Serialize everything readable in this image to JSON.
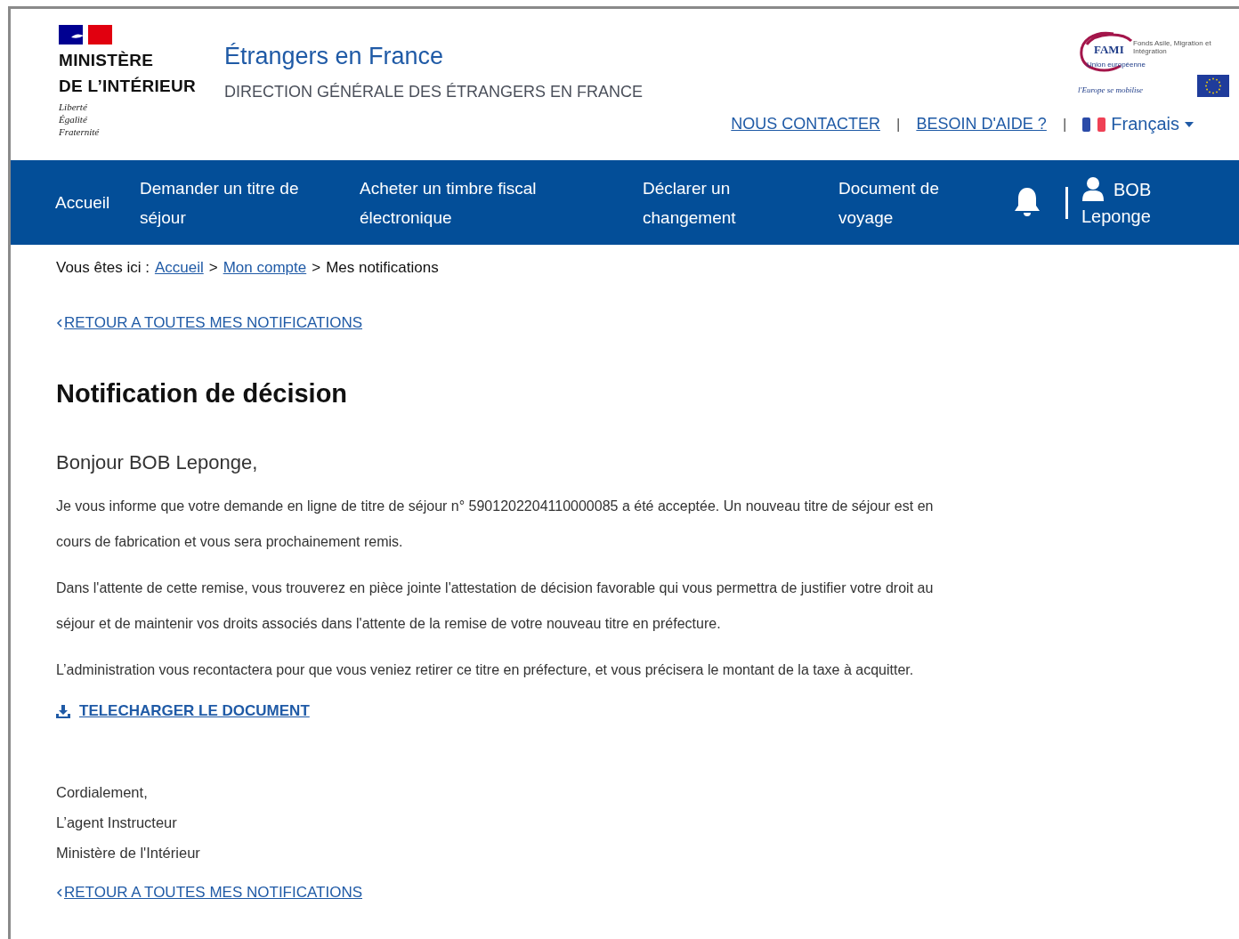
{
  "header": {
    "ministry_name": [
      "MINISTÈRE",
      "DE L’INTÉRIEUR"
    ],
    "motto": [
      "Liberté",
      "Égalité",
      "Fraternité"
    ],
    "site_title": "Étrangers en France",
    "site_subtitle": "DIRECTION GÉNÉRALE DES ÉTRANGERS EN FRANCE",
    "fami_logo": {
      "name": "FAMI",
      "fund": "Fonds Asile, Migration et Intégration",
      "union": "Union européenne",
      "slogan": "l'Europe se mobilise"
    },
    "links": [
      "NOUS CONTACTER",
      "BESOIN D'AIDE ?"
    ],
    "separators": [
      "|",
      "|"
    ],
    "language": "Français"
  },
  "nav": {
    "items": [
      {
        "label": "Accueil"
      },
      {
        "label": "Demander un titre de séjour"
      },
      {
        "label": "Acheter un timbre fiscal électronique"
      },
      {
        "label": "Déclarer un changement"
      },
      {
        "label": "Document de voyage"
      }
    ],
    "user": {
      "first": "BOB",
      "last": "Leponge"
    }
  },
  "breadcrumb": {
    "prefix": "Vous êtes ici :",
    "items": [
      {
        "label": "Accueil",
        "link": true
      },
      {
        "label": "Mon compte",
        "link": true
      },
      {
        "label": "Mes notifications",
        "link": false
      }
    ],
    "separator": ">"
  },
  "back_link": "RETOUR A TOUTES MES NOTIFICATIONS",
  "title": "Notification de décision",
  "greeting": "Bonjour BOB Leponge,",
  "paragraphs": [
    "Je vous informe que votre demande en ligne de titre de séjour n° 5901202204110000085 a été acceptée. Un nouveau titre de séjour est en cours de fabrication et vous sera prochainement remis.",
    "Dans l'attente de cette remise, vous trouverez en pièce jointe l'attestation de décision favorable qui vous permettra de justifier votre droit au séjour et de maintenir vos droits associés dans l'attente de la remise de votre nouveau titre en préfecture.",
    "L’administration vous recontactera pour que vous veniez retirer ce titre en préfecture, et vous précisera le montant de la taxe à acquitter."
  ],
  "download_link": "TELECHARGER LE DOCUMENT",
  "signature": [
    "Cordialement,",
    "L’agent Instructeur",
    "Ministère de l'Intérieur"
  ],
  "back_link_bottom": "RETOUR A TOUTES MES NOTIFICATIONS"
}
